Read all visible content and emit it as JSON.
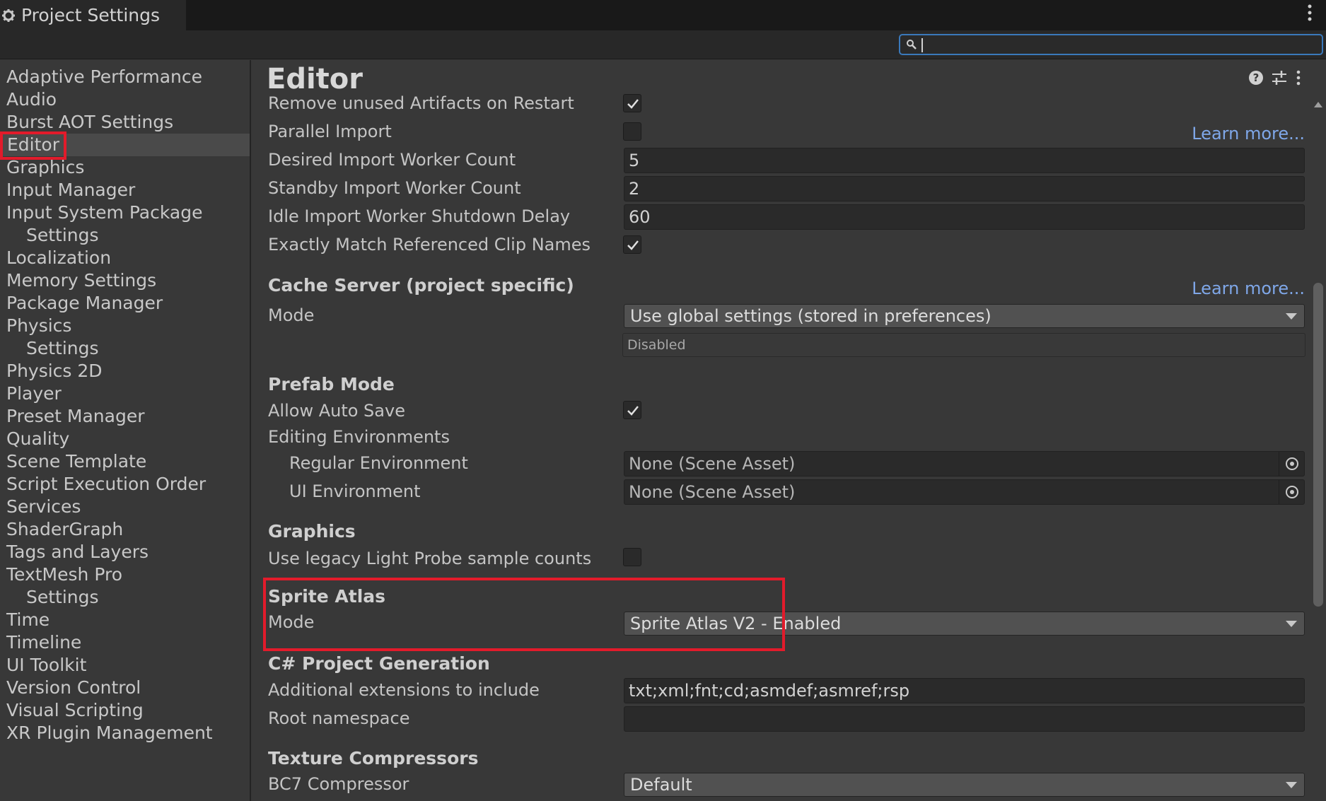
{
  "window": {
    "tab_title": "Project Settings"
  },
  "search": {
    "placeholder": "",
    "value": ""
  },
  "sidebar": {
    "items": [
      {
        "label": "Adaptive Performance"
      },
      {
        "label": "Audio"
      },
      {
        "label": "Burst AOT Settings"
      },
      {
        "label": "Editor",
        "selected": true
      },
      {
        "label": "Graphics"
      },
      {
        "label": "Input Manager"
      },
      {
        "label": "Input System Package"
      },
      {
        "label": "Settings"
      },
      {
        "label": "Localization"
      },
      {
        "label": "Memory Settings"
      },
      {
        "label": "Package Manager"
      },
      {
        "label": "Physics"
      },
      {
        "label": "Settings"
      },
      {
        "label": "Physics 2D"
      },
      {
        "label": "Player"
      },
      {
        "label": "Preset Manager"
      },
      {
        "label": "Quality"
      },
      {
        "label": "Scene Template"
      },
      {
        "label": "Script Execution Order"
      },
      {
        "label": "Services"
      },
      {
        "label": "ShaderGraph"
      },
      {
        "label": "Tags and Layers"
      },
      {
        "label": "TextMesh Pro"
      },
      {
        "label": "Settings"
      },
      {
        "label": "Time"
      },
      {
        "label": "Timeline"
      },
      {
        "label": "UI Toolkit"
      },
      {
        "label": "Version Control"
      },
      {
        "label": "Visual Scripting"
      },
      {
        "label": "XR Plugin Management"
      }
    ]
  },
  "content": {
    "title": "Editor",
    "learn_more": "Learn more...",
    "asset_pipeline": {
      "remove_unused_label": "Remove unused Artifacts on Restart",
      "remove_unused_checked": true,
      "parallel_import_label": "Parallel Import",
      "parallel_import_checked": false,
      "desired_workers_label": "Desired Import Worker Count",
      "desired_workers_value": "5",
      "standby_workers_label": "Standby Import Worker Count",
      "standby_workers_value": "2",
      "idle_shutdown_label": "Idle Import Worker Shutdown Delay",
      "idle_shutdown_value": "60",
      "exact_clip_label": "Exactly Match Referenced Clip Names",
      "exact_clip_checked": true
    },
    "cache_server": {
      "heading": "Cache Server (project specific)",
      "mode_label": "Mode",
      "mode_value": "Use global settings (stored in preferences)",
      "status": "Disabled"
    },
    "prefab_mode": {
      "heading": "Prefab Mode",
      "auto_save_label": "Allow Auto Save",
      "auto_save_checked": true,
      "editing_env_label": "Editing Environments",
      "regular_env_label": "Regular Environment",
      "regular_env_value": "None (Scene Asset)",
      "ui_env_label": "UI Environment",
      "ui_env_value": "None (Scene Asset)"
    },
    "graphics": {
      "heading": "Graphics",
      "legacy_probe_label": "Use legacy Light Probe sample counts",
      "legacy_probe_checked": false
    },
    "sprite_atlas": {
      "heading": "Sprite Atlas",
      "mode_label": "Mode",
      "mode_value": "Sprite Atlas V2 - Enabled"
    },
    "csharp": {
      "heading": "C# Project Generation",
      "extensions_label": "Additional extensions to include",
      "extensions_value": "txt;xml;fnt;cd;asmdef;asmref;rsp",
      "root_ns_label": "Root namespace",
      "root_ns_value": ""
    },
    "texture_compressors": {
      "heading": "Texture Compressors",
      "bc7_label": "BC7 Compressor",
      "bc7_value": "Default"
    }
  },
  "icons": {
    "tab": "gear-icon",
    "search": "search-icon",
    "help": "help-icon",
    "presets": "sliders-icon",
    "menu": "kebab-menu-icon",
    "object_picker": "object-picker-icon",
    "checkmark": "checkmark-icon"
  },
  "colors": {
    "highlight": "#e21b2b",
    "link": "#7fa7e8",
    "search_border": "#3a79bb"
  }
}
